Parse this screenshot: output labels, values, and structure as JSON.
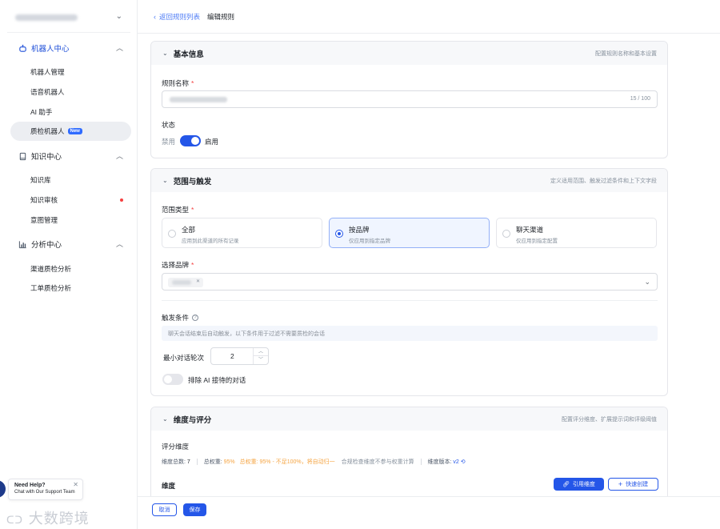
{
  "sidebar": {
    "groups": [
      {
        "label": "机器人中心",
        "icon": "robot-icon",
        "items": [
          {
            "label": "机器人管理"
          },
          {
            "label": "语音机器人"
          },
          {
            "label": "AI 助手"
          },
          {
            "label": "质检机器人",
            "badge": "New",
            "selected": true
          }
        ]
      },
      {
        "label": "知识中心",
        "icon": "book-icon",
        "items": [
          {
            "label": "知识库"
          },
          {
            "label": "知识审核",
            "dot": true
          },
          {
            "label": "意图管理"
          }
        ]
      },
      {
        "label": "分析中心",
        "icon": "bar-chart-icon",
        "items": [
          {
            "label": "渠道质检分析"
          },
          {
            "label": "工单质检分析"
          }
        ]
      }
    ],
    "help": {
      "title": "Need Help?",
      "subtitle": "Chat with Our Support Team"
    },
    "watermark": "大数跨境"
  },
  "header": {
    "back_label": "返回规则列表",
    "current": "编辑规则"
  },
  "sections": {
    "basic": {
      "title": "基本信息",
      "desc": "配置规则名称和基本设置",
      "name_label": "规则名称",
      "name_counter": "15 / 100",
      "status_label": "状态",
      "status_off": "禁用",
      "status_on": "启用",
      "status_enabled": true
    },
    "scope": {
      "title": "范围与触发",
      "desc": "定义适用范围、触发过滤条件和上下文字段",
      "scope_type_label": "范围类型",
      "options": [
        {
          "title": "全部",
          "desc": "应用到此渠道的所有记录"
        },
        {
          "title": "按品牌",
          "desc": "仅应用到指定品牌",
          "selected": true
        },
        {
          "title": "聊天渠道",
          "desc": "仅应用到指定配置"
        }
      ],
      "brand_label": "选择品牌",
      "trigger_label": "触发条件",
      "trigger_hint": "聊天会话结束后自动触发，以下条件用于过滤不需要质检的会话",
      "min_rounds_label": "最小对话轮次",
      "min_rounds_value": "2",
      "exclude_ai_label": "排除 AI 接待的对话",
      "exclude_ai_enabled": false
    },
    "dimensions": {
      "title": "维度与评分",
      "desc": "配置评分维度、扩展提示词和评级阈值",
      "subtitle": "评分维度",
      "stats_total_label": "维度总数:",
      "stats_total_value": "7",
      "stats_weight_label": "总权重:",
      "stats_weight_value": "95%",
      "stats_weight_warning": "总权重: 95% - 不足100%，将自动归一",
      "stats_note": "合规检查维度不参与权重计算",
      "stats_version_label": "维度版本:",
      "stats_version_value": "v2",
      "dim_label": "维度",
      "ref_button": "引用维度",
      "quick_button": "快速创建"
    }
  },
  "footer": {
    "cancel": "取消",
    "save": "保存"
  },
  "colors": {
    "primary": "#2456e8",
    "required": "#f53f3f",
    "warning": "#f5a442"
  }
}
